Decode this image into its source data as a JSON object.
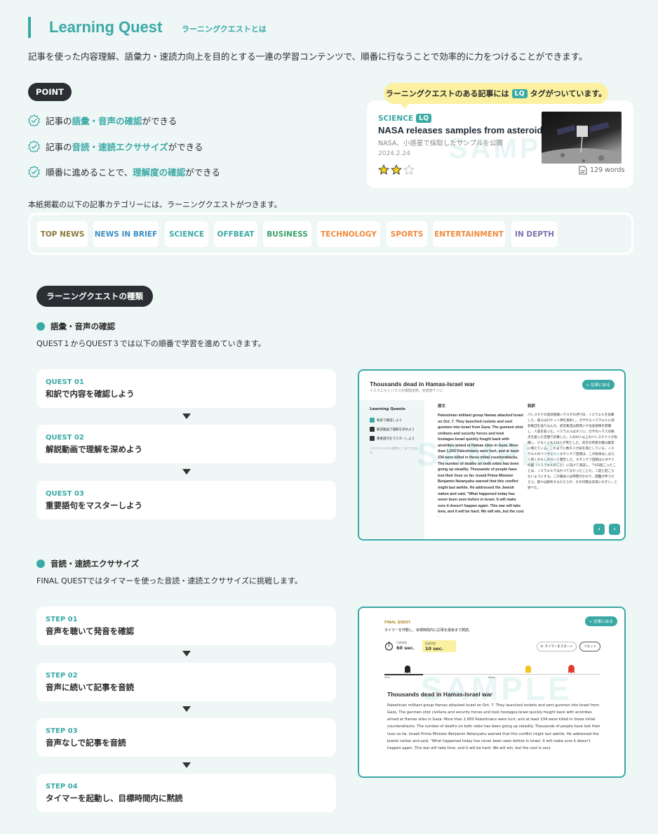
{
  "header": {
    "title": "Learning Quest",
    "subtitle": "ラーニングクエストとは",
    "intro": "記事を使った内容理解、語彙力・速読力向上を目的とする一連の学習コンテンツで、順番に行なうことで効率的に力をつけることができます。"
  },
  "point": {
    "label": "POINT",
    "items": [
      {
        "pre": "記事の",
        "hl": "語彙・音声の確認",
        "post": "ができる"
      },
      {
        "pre": "記事の",
        "hl": "音読・速読エクササイズ",
        "post": "ができる"
      },
      {
        "pre": "順番に進めることで、",
        "hl": "理解度の確認",
        "post": "ができる"
      }
    ]
  },
  "bubble": {
    "pre": "ラーニングクエストのある記事には",
    "tag": "LQ",
    "post": "タグがついています。"
  },
  "card": {
    "category": "SCIENCE",
    "tag": "LQ",
    "title": "NASA releases samples from asteroid",
    "jp": "NASA、小惑星で採取したサンプルを公開",
    "date": "2024.2.24",
    "stars_filled": 2,
    "stars_total": 3,
    "words": "129 words",
    "watermark": "SAMPLE"
  },
  "categories": {
    "intro": "本紙掲載の以下の記事カテゴリーには、ラーニングクエストがつきます。",
    "items": [
      {
        "label": "TOP NEWS",
        "color": "#8b7a3c"
      },
      {
        "label": "NEWS IN BRIEF",
        "color": "#3a8ec2"
      },
      {
        "label": "SCIENCE",
        "color": "#3aa9a5"
      },
      {
        "label": "OFFBEAT",
        "color": "#3aa9a5"
      },
      {
        "label": "BUSINESS",
        "color": "#3aa06a"
      },
      {
        "label": "TECHNOLOGY",
        "color": "#f08a3c"
      },
      {
        "label": "SPORTS",
        "color": "#f08a3c"
      },
      {
        "label": "ENTERTAINMENT",
        "color": "#f08a3c"
      },
      {
        "label": "IN DEPTH",
        "color": "#7b6fae"
      }
    ]
  },
  "types": {
    "label": "ラーニングクエストの種類",
    "vocab": {
      "heading": "語彙・音声の確認",
      "desc": "QUEST１からQUEST３では以下の順番で学習を進めていきます。",
      "steps": [
        {
          "label": "QUEST 01",
          "text": "和訳で内容を確認しよう"
        },
        {
          "label": "QUEST 02",
          "text": "解説動画で理解を深めよう"
        },
        {
          "label": "QUEST 03",
          "text": "重要語句をマスターしよう"
        }
      ]
    },
    "reading": {
      "heading": "音読・速読エクササイズ",
      "desc": "FINAL QUESTではタイマーを使った音読・速読エクササイズに挑戦します。",
      "steps": [
        {
          "label": "STEP 01",
          "text": "音声を聴いて発音を確認"
        },
        {
          "label": "STEP 02",
          "text": "音声に続いて記事を音読"
        },
        {
          "label": "STEP 03",
          "text": "音声なしで記事を音読"
        },
        {
          "label": "STEP 04",
          "text": "タイマーを起動し、目標時間内に黙読"
        }
      ]
    }
  },
  "shot1": {
    "title": "Thousands dead in Hamas-Israel war",
    "subtitle": "イスラエルとハマスが戦闘状態、死者数千人に",
    "back": "記事に戻る",
    "side_title": "Learning Quests",
    "side_items": [
      "和訳で確認しよう",
      "解説動画で理解を深めよう",
      "重要語句をマスターしよう"
    ],
    "side_note": "このクエストから全問中ここまでできます。",
    "col_en_head": "原文",
    "col_jp_head": "和訳",
    "en_text": "Palestinian militant group Hamas attacked Israel on Oct. 7. They launched rockets and sent gunmen into Israel from Gaza. The gunmen shot civilians and security forces and took hostages.Israel quickly fought back with airstrikes aimed at Hamas sites in Gaza. More than 1,600 Palestinians were hurt, and at least 234 were killed in these initial counterattacks. The number of deaths on both sides has been going up steadily. Thousands of people have lost their lives so far. Israeli Prime Minister Benjamin Netanyahu warned that this conflict might last awhile. He addressed the Jewish nation and said, \"What happened today has never been seen before in Israel. It will make sure it doesn't happen again. This war will take time, and it will be hard. We will win, but the cost is very",
    "jp_text": "パレスチナの武装組織ハマスが10月7日、イスラエルを攻撃した。彼らはロケット弾を発射し、ガザからイスラエルに武装集団を送り込んだ。武装集団は民間人や治安部隊を銃撃し、人質を取った。イスラエルはすぐに、ガザのハマスの拠点を狙った空爆で反撃した。1,600人以上のパレスチナ人が負傷し、少なくとも234人が死亡した。双方の死者の数は着実に増えている。これまでに数千人が命を落としている。イスラエルのベンヤミン・ネタニヤフ首相は、この紛争はしばらく続くかもしれないと警告した。ネタニヤフ首相はユダヤ人の国（イスラエルのこと）に向けて演説し、「今日起こったことは、イスラエルではかつてなかったことだ。二度と起こらないようにする。この戦争には時間がかかり、困難が伴うだろう。我々は勝利するだろうが、その代償は非常に大きい」と述べた。",
    "watermark": "SAMPLE"
  },
  "shot2": {
    "label": "FINAL QUEST",
    "desc": "タイマーを作動し、目標時間内に記事を最後まで黙読。",
    "back": "記事に戻る",
    "timer1_label": "目標時間",
    "timer1_value": "60 sec.",
    "timer2_label": "経過時間",
    "timer2_value": "10 sec.",
    "start_btn": "タイマーをスタート",
    "reset_btn": "リセット",
    "track_start": "0sec.",
    "track_mid": "60sec.",
    "title": "Thousands dead in Hamas-Israel war",
    "text": "Palestinian militant group Hamas attacked Israel on Oct. 7. They launched rockets and sent gunmen into Israel from Gaza. The gunmen shot civilians and security forces and took hostages.Israel quickly fought back with airstrikes aimed at Hamas sites in Gaza. More than 1,600 Palestinians were hurt, and at least 234 were killed in these initial counterattacks. The number of deaths on both sides has been going up steadily. Thousands of people have lost their lives so far. Israeli Prime Minister Benjamin Netanyahu warned that this conflict might last awhile. He addressed the Jewish nation and said, \"What happened today has never been seen before in Israel. It will make sure it doesn't happen again. This war will take time, and it will be hard. We will win, but the cost is very",
    "watermark": "SAMPLE"
  }
}
